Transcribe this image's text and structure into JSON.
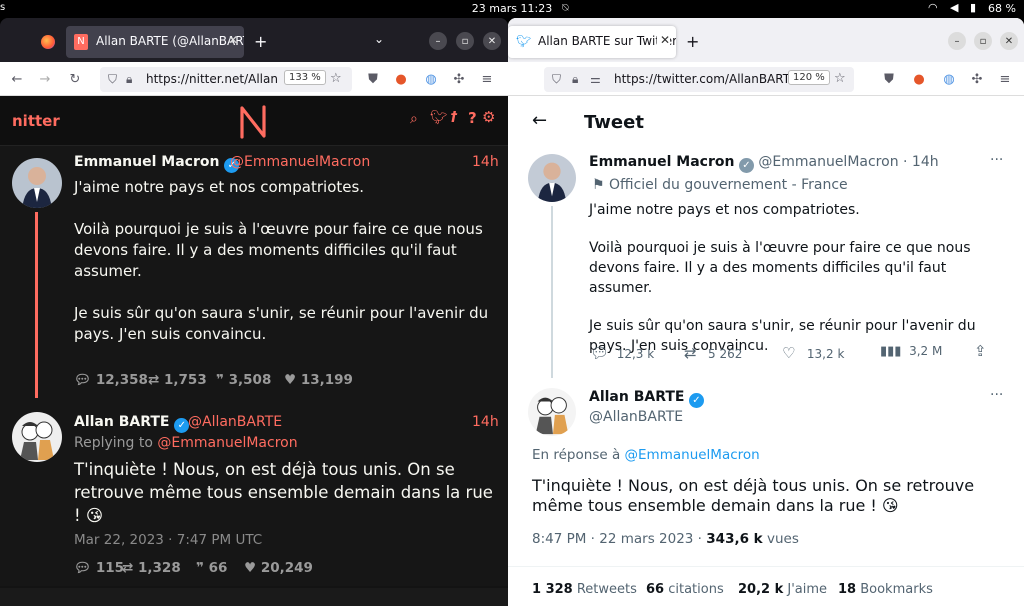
{
  "system": {
    "datetime": "23 mars  11:23",
    "battery": "68 %"
  },
  "win1": {
    "tab_title": "Allan BARTE (@AllanBARTE",
    "url": "https://nitter.net/Allan",
    "zoom": "133 %",
    "brand": "nitter",
    "tweet1": {
      "name": "Emmanuel Macron",
      "handle": "@EmmanuelMacron",
      "time": "14h",
      "p1": "J'aime notre pays et nos compatriotes.",
      "p2": "Voilà pourquoi je suis à l'œuvre pour faire ce que nous devons faire. Il y a des moments difficiles qu'il faut assumer.",
      "p3": "Je suis sûr qu'on saura s'unir, se réunir pour l'avenir du pays. J'en suis convaincu.",
      "replies": "12,358",
      "retweets": "1,753",
      "quotes": "3,508",
      "likes": "13,199"
    },
    "tweet2": {
      "name": "Allan BARTE",
      "handle": "@AllanBARTE",
      "time": "14h",
      "replying_prefix": "Replying to",
      "replying_handle": "@EmmanuelMacron",
      "text": "T'inquiète ! Nous, on est déjà tous unis. On se retrouve même tous ensemble demain dans la rue ! 😘",
      "date": "Mar 22, 2023 · 7:47 PM UTC",
      "replies": "115",
      "retweets": "1,328",
      "quotes": "66",
      "likes": "20,249"
    }
  },
  "win2": {
    "tab_title": "Allan BARTE sur Twitter : ",
    "url": "https://twitter.com/AllanBART",
    "zoom": "120 %",
    "header_title": "Tweet",
    "tweet1": {
      "name": "Emmanuel Macron",
      "handle": "@EmmanuelMacron · 14h",
      "label": "Officiel du gouvernement - France",
      "p1": "J'aime notre pays et nos compatriotes.",
      "p2": "Voilà pourquoi je suis à l'œuvre pour faire ce que nous devons faire. Il y a des moments difficiles qu'il faut assumer.",
      "p3": "Je suis sûr qu'on saura s'unir, se réunir pour l'avenir du pays. J'en suis convaincu.",
      "replies": "12,3 k",
      "retweets": "5 262",
      "likes": "13,2 k",
      "views": "3,2 M"
    },
    "tweet2": {
      "name": "Allan BARTE",
      "handle": "@AllanBARTE",
      "reply_prefix": "En réponse à",
      "reply_handle": "@EmmanuelMacron",
      "text": "T'inquiète ! Nous, on est déjà tous unis. On se retrouve même tous ensemble demain dans la rue ! 😘",
      "date": "8:47 PM · 22 mars 2023 ·",
      "views_count": "343,6 k",
      "views_label": "vues",
      "retweets_count": "1 328",
      "retweets_label": "Retweets",
      "quotes_count": "66",
      "quotes_label": "citations",
      "likes_count": "20,2 k",
      "likes_label": "J'aime",
      "bookmarks_count": "18",
      "bookmarks_label": "Bookmarks"
    }
  }
}
